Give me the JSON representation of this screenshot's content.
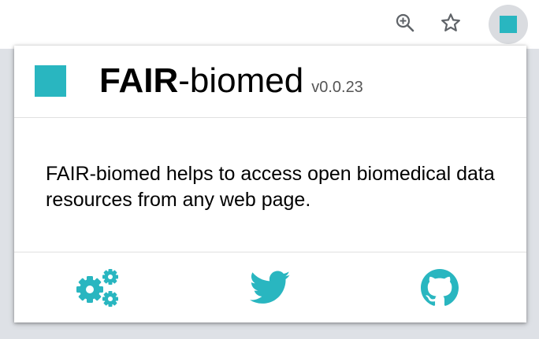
{
  "browser": {
    "toolbar_icons": [
      "zoom-in-icon",
      "star-icon"
    ],
    "extension_icon": "fair-biomed-extension-icon"
  },
  "popup": {
    "title_bold": "FAIR",
    "title_rest": "-biomed",
    "version": "v0.0.23",
    "description": "FAIR-biomed helps to access open biomedical data resources from any web page.",
    "footer_icons": [
      "settings-icon",
      "twitter-icon",
      "github-icon"
    ]
  },
  "colors": {
    "accent": "#29b6c0",
    "toolbar_bg": "#ffffff",
    "frame_bg": "#dee1e6"
  }
}
